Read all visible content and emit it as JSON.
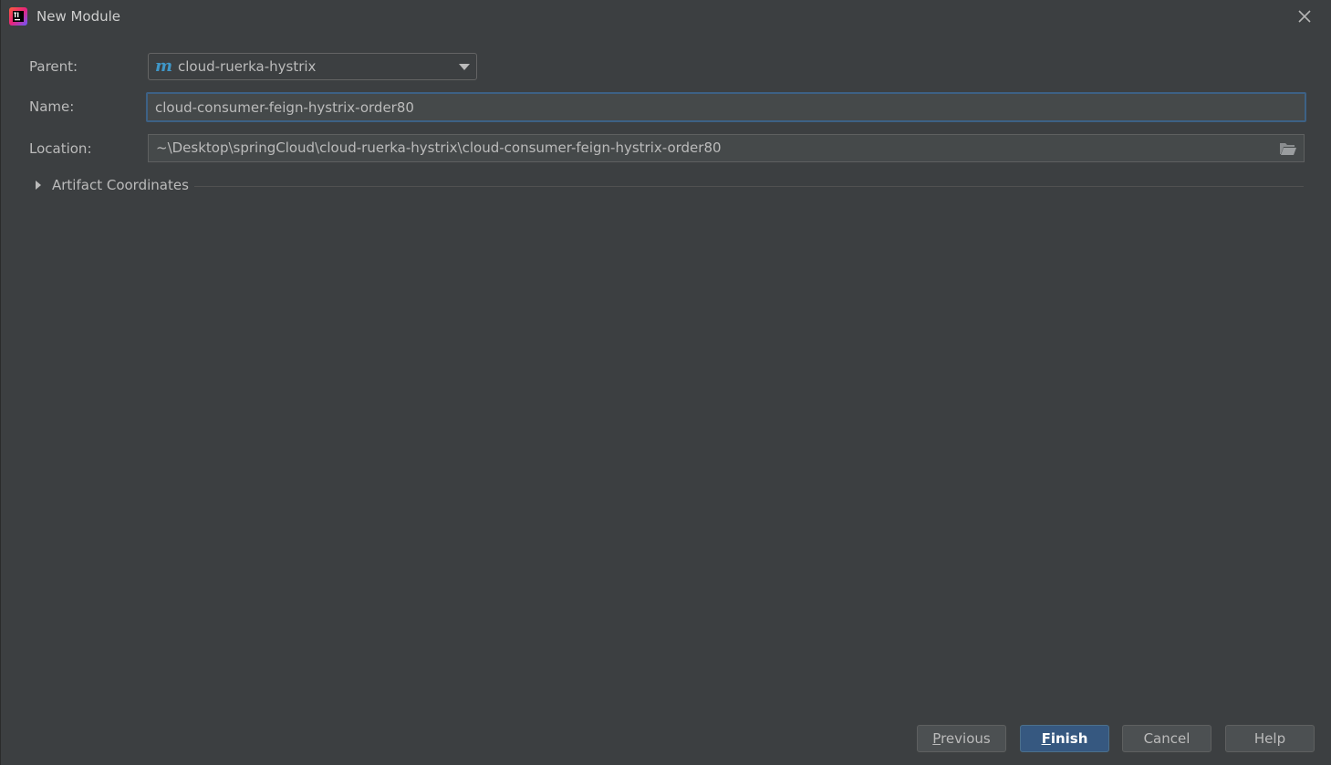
{
  "window": {
    "title": "New Module",
    "app_icon": "intellij-idea-icon",
    "close_icon": "close-icon"
  },
  "form": {
    "parent_label": "Parent:",
    "parent_value": "cloud-ruerka-hystrix",
    "parent_icon": "maven-module-icon",
    "parent_icon_glyph": "m",
    "name_label": "Name:",
    "name_value": "cloud-consumer-feign-hystrix-order80",
    "location_label": "Location:",
    "location_value": "~\\Desktop\\springCloud\\cloud-ruerka-hystrix\\cloud-consumer-feign-hystrix-order80",
    "browse_icon": "folder-open-icon"
  },
  "artifact": {
    "label": "Artifact Coordinates",
    "expanded": false
  },
  "buttons": {
    "previous_mnemonic": "P",
    "previous_rest": "revious",
    "finish_mnemonic": "F",
    "finish_rest": "inish",
    "cancel": "Cancel",
    "help": "Help"
  },
  "colors": {
    "background": "#3c3f41",
    "field_background": "#45494a",
    "focus_border": "#3d6185",
    "primary_button": "#365880",
    "maven_icon": "#3f97c8"
  }
}
